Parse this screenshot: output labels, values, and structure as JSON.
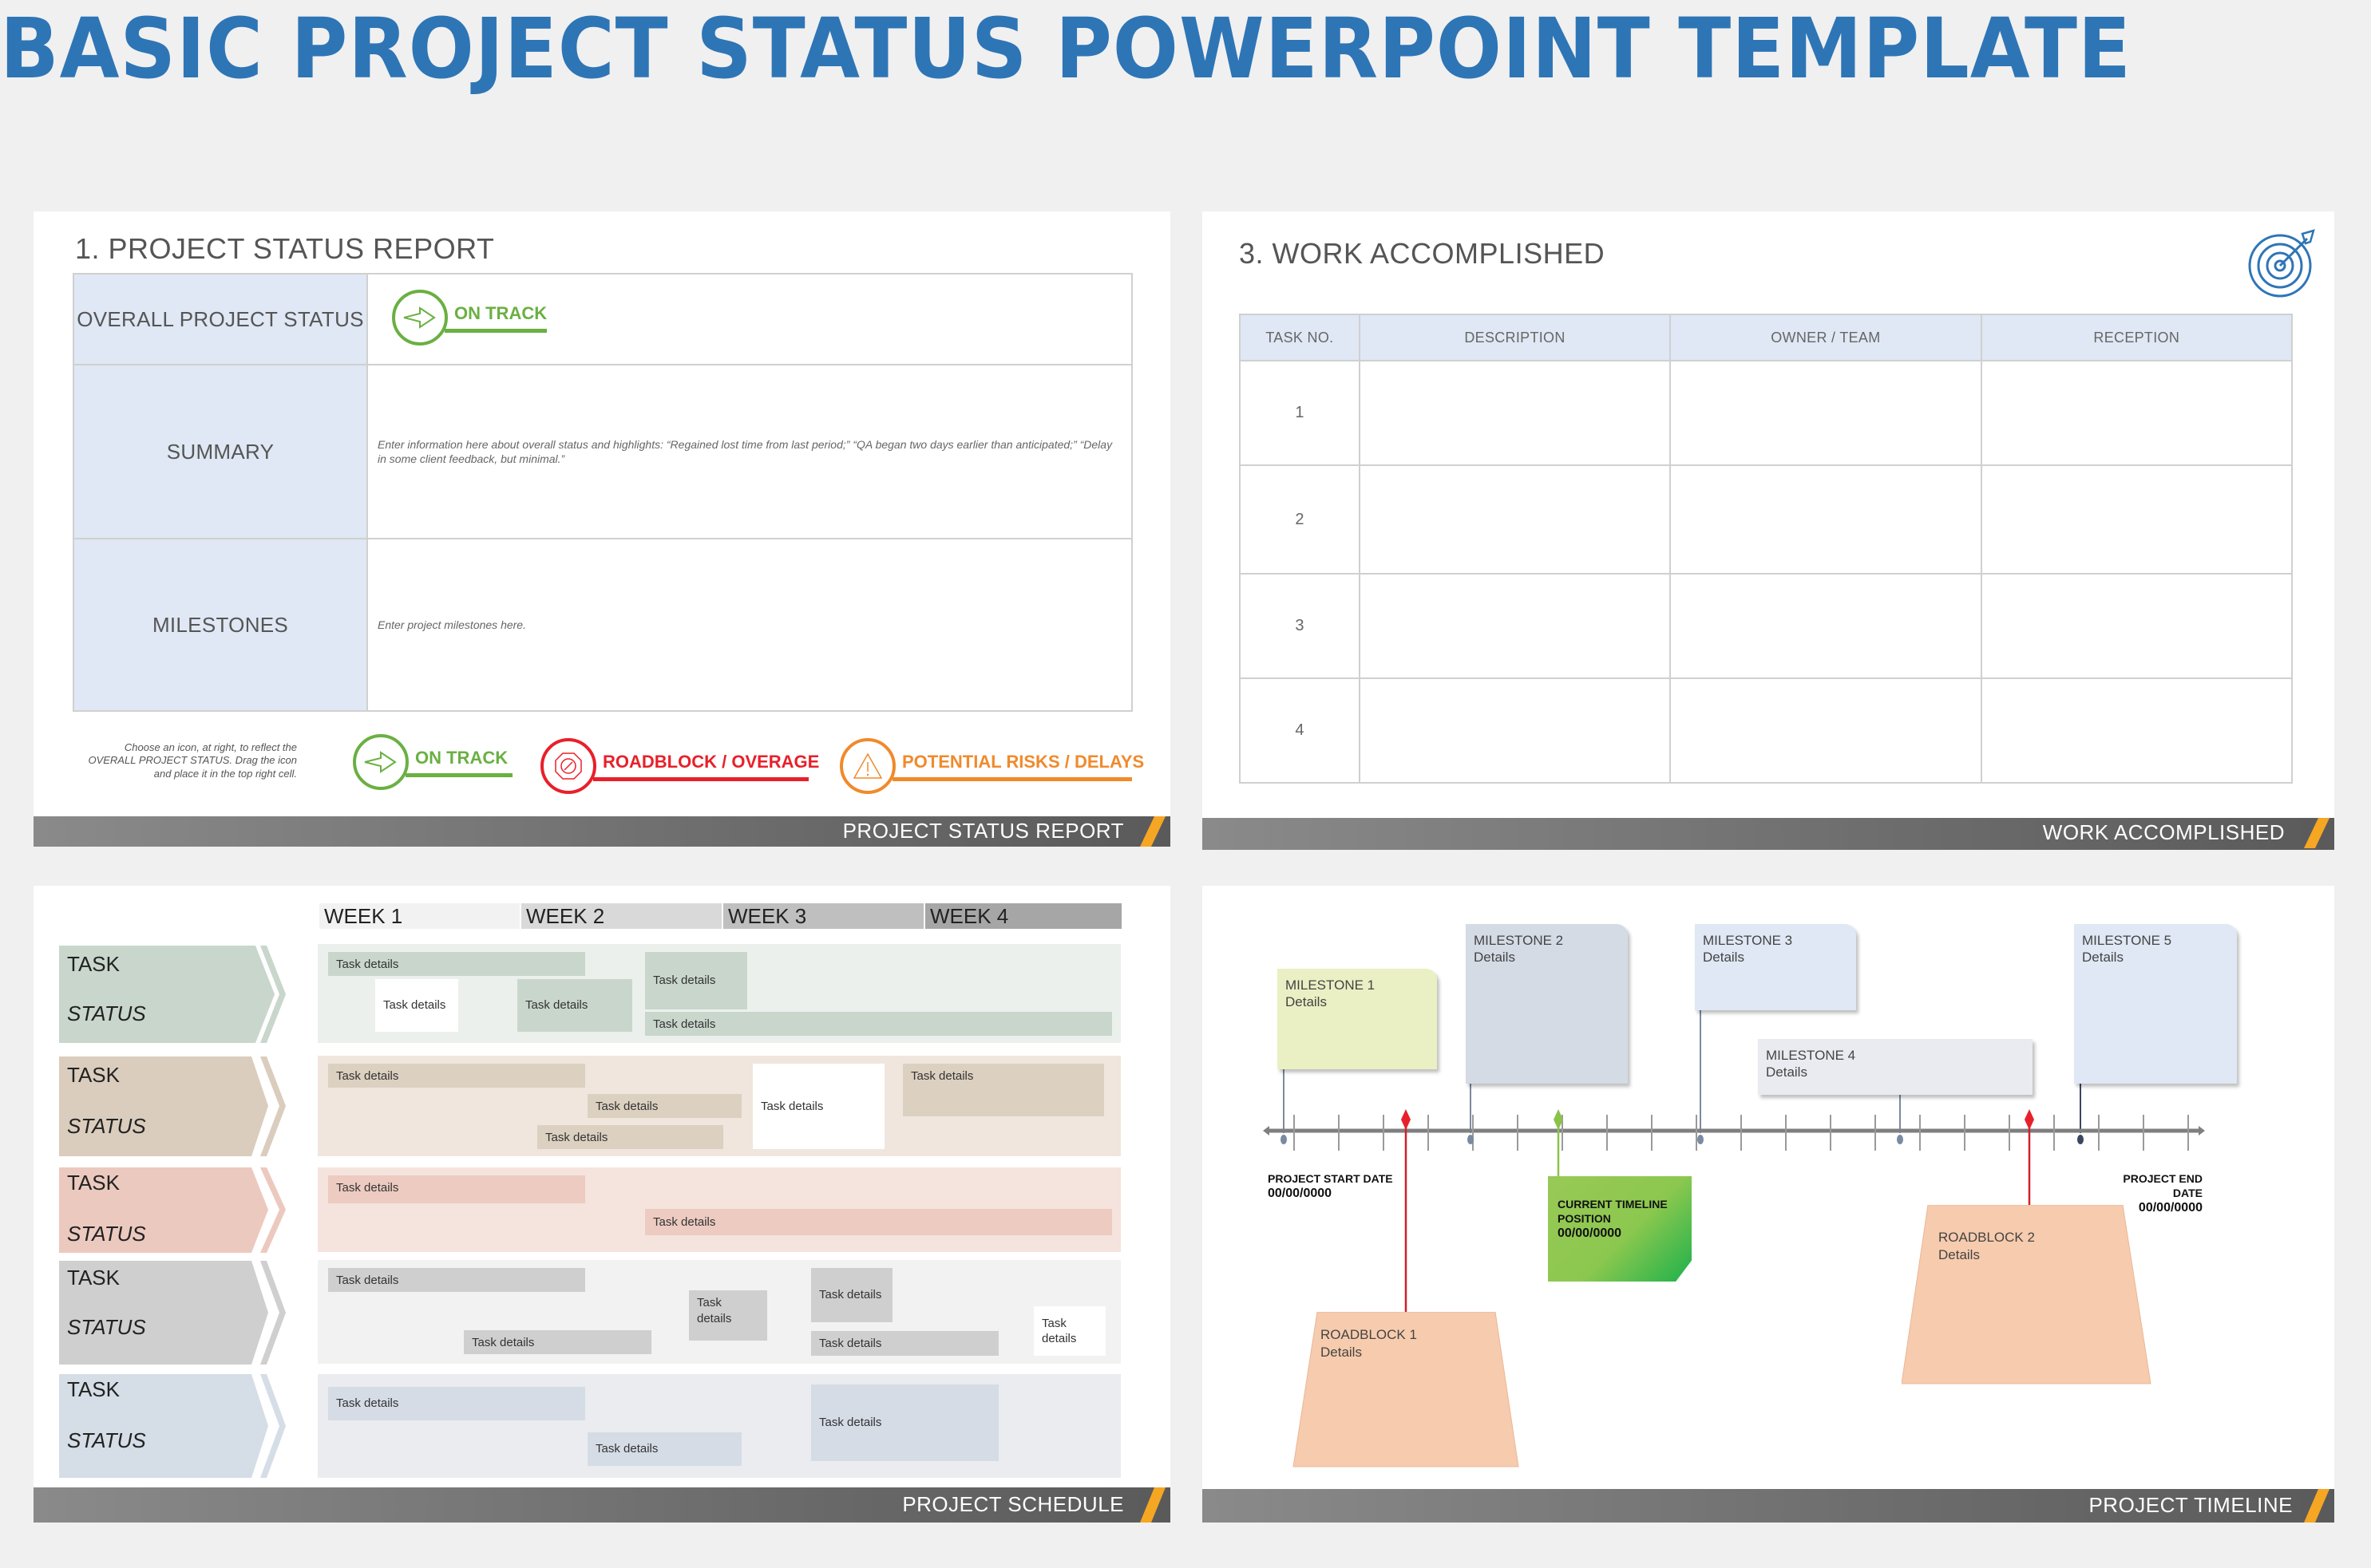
{
  "page_title": "BASIC PROJECT STATUS POWERPOINT TEMPLATE",
  "slides": {
    "status_report": {
      "heading": "1. PROJECT STATUS REPORT",
      "rows": [
        {
          "label": "OVERALL PROJECT STATUS",
          "status": "ON TRACK"
        },
        {
          "label": "SUMMARY",
          "content": "Enter information here about overall status and highlights: “Regained lost time from last period;” “QA began two days earlier than anticipated;” “Delay in some client feedback, but minimal.”"
        },
        {
          "label": "MILESTONES",
          "content": "Enter project milestones here."
        }
      ],
      "hint": "Choose an icon, at right, to reflect the OVERALL PROJECT STATUS. Drag the icon and place it in the top right cell.",
      "status_options": [
        {
          "label": "ON TRACK",
          "icon": "arrow-right-icon",
          "color": "#6ab042"
        },
        {
          "label": "ROADBLOCK / OVERAGE",
          "icon": "stop-sign-icon",
          "color": "#e8202a"
        },
        {
          "label": "POTENTIAL RISKS / DELAYS",
          "icon": "warning-triangle-icon",
          "color": "#f08a2c"
        }
      ],
      "footer": "PROJECT STATUS REPORT"
    },
    "work_accomplished": {
      "heading": "3. WORK ACCOMPLISHED",
      "icon": "target-icon",
      "columns": [
        "TASK NO.",
        "DESCRIPTION",
        "OWNER / TEAM",
        "RECEPTION"
      ],
      "rows": [
        [
          "1",
          "",
          "",
          ""
        ],
        [
          "2",
          "",
          "",
          ""
        ],
        [
          "3",
          "",
          "",
          ""
        ],
        [
          "4",
          "",
          "",
          ""
        ]
      ],
      "footer": "WORK ACCOMPLISHED"
    },
    "schedule": {
      "weeks": [
        "WEEK 1",
        "WEEK 2",
        "WEEK 3",
        "WEEK 4"
      ],
      "lanes": [
        {
          "task": "TASK",
          "status": "STATUS",
          "bars": [
            "Task details",
            "Task details",
            "Task details",
            "Task details",
            "Task details"
          ]
        },
        {
          "task": "TASK",
          "status": "STATUS",
          "bars": [
            "Task details",
            "Task details",
            "Task details",
            "Task details",
            "Task details"
          ]
        },
        {
          "task": "TASK",
          "status": "STATUS",
          "bars": [
            "Task details",
            "Task details"
          ]
        },
        {
          "task": "TASK",
          "status": "STATUS",
          "bars": [
            "Task details",
            "Task details",
            "Task details",
            "Task details",
            "Task details",
            "Task details"
          ]
        },
        {
          "task": "TASK",
          "status": "STATUS",
          "bars": [
            "Task details",
            "Task details",
            "Task details"
          ]
        }
      ],
      "footer": "PROJECT SCHEDULE"
    },
    "timeline": {
      "milestones": [
        {
          "title": "MILESTONE 1",
          "details": "Details"
        },
        {
          "title": "MILESTONE 2",
          "details": "Details"
        },
        {
          "title": "MILESTONE 3",
          "details": "Details"
        },
        {
          "title": "MILESTONE 4",
          "details": "Details"
        },
        {
          "title": "MILESTONE 5",
          "details": "Details"
        }
      ],
      "roadblocks": [
        {
          "title": "ROADBLOCK 1",
          "details": "Details"
        },
        {
          "title": "ROADBLOCK 2",
          "details": "Details"
        }
      ],
      "start": {
        "label": "PROJECT START DATE",
        "date": "00/00/0000"
      },
      "end": {
        "label_line1": "PROJECT END",
        "label_line2": "DATE",
        "date": "00/00/0000"
      },
      "current": {
        "label_line1": "CURRENT TIMELINE",
        "label_line2": "POSITION",
        "date": "00/00/0000"
      },
      "footer": "PROJECT TIMELINE"
    }
  },
  "colors": {
    "title_blue": "#2e75b6",
    "footer_accent": "#f5a623",
    "header_fill": "#dfe8f4"
  }
}
